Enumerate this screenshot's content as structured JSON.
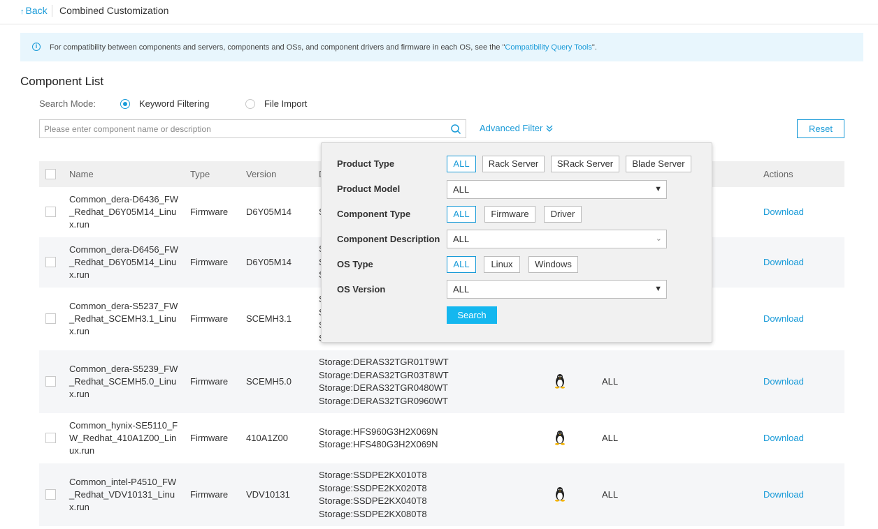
{
  "header": {
    "back_arrow": "↑",
    "back_label": "Back",
    "title": "Combined Customization"
  },
  "notice": {
    "icon": "info-icon",
    "text_before": "For compatibility between components and servers, components and OSs, and component drivers and firmware in each OS, see the \"",
    "link": "Compatibility Query Tools",
    "text_after": "\"."
  },
  "section_title": "Component List",
  "search_mode": {
    "label": "Search Mode:",
    "options": [
      "Keyword Filtering",
      "File Import"
    ],
    "selected": "Keyword Filtering"
  },
  "search": {
    "placeholder": "Please enter component name or description",
    "value": ""
  },
  "advanced_filter_label": "Advanced Filter",
  "reset_label": "Reset",
  "table": {
    "columns": [
      "Name",
      "Type",
      "Version",
      "D",
      "Actions"
    ],
    "rows": [
      {
        "name": "Common_dera-D6436_FW_Redhat_D6Y05M14_Linux.run",
        "type": "Firmware",
        "version": "D6Y05M14",
        "desc": [
          "S"
        ],
        "os": "",
        "os_version": "",
        "action": "Download"
      },
      {
        "name": "Common_dera-D6456_FW_Redhat_D6Y05M14_Linux.run",
        "type": "Firmware",
        "version": "D6Y05M14",
        "desc": [
          "S",
          "S",
          "S"
        ],
        "os": "",
        "os_version": "",
        "action": "Download"
      },
      {
        "name": "Common_dera-S5237_FW_Redhat_SCEMH3.1_Linux.run",
        "type": "Firmware",
        "version": "SCEMH3.1",
        "desc": [
          "S",
          "S",
          "S",
          "S"
        ],
        "os": "",
        "os_version": "",
        "action": "Download"
      },
      {
        "name": "Common_dera-S5239_FW_Redhat_SCEMH5.0_Linux.run",
        "type": "Firmware",
        "version": "SCEMH5.0",
        "desc": [
          "Storage:DERAS32TGR01T9WT",
          "Storage:DERAS32TGR03T8WT",
          "Storage:DERAS32TGR0480WT",
          "Storage:DERAS32TGR0960WT"
        ],
        "os": "linux-penguin-icon",
        "os_version": "ALL",
        "action": "Download"
      },
      {
        "name": "Common_hynix-SE5110_FW_Redhat_410A1Z00_Linux.run",
        "type": "Firmware",
        "version": "410A1Z00",
        "desc": [
          "Storage:HFS960G3H2X069N",
          "Storage:HFS480G3H2X069N"
        ],
        "os": "linux-penguin-icon",
        "os_version": "ALL",
        "action": "Download"
      },
      {
        "name": "Common_intel-P4510_FW_Redhat_VDV10131_Linux.run",
        "type": "Firmware",
        "version": "VDV10131",
        "desc": [
          "Storage:SSDPE2KX010T8",
          "Storage:SSDPE2KX020T8",
          "Storage:SSDPE2KX040T8",
          "Storage:SSDPE2KX080T8"
        ],
        "os": "linux-penguin-icon",
        "os_version": "ALL",
        "action": "Download"
      }
    ]
  },
  "filter_popup": {
    "product_type": {
      "label": "Product Type",
      "options": [
        "ALL",
        "Rack Server",
        "SRack Server",
        "Blade Server"
      ],
      "selected": "ALL"
    },
    "product_model": {
      "label": "Product Model",
      "value": "ALL"
    },
    "component_type": {
      "label": "Component Type",
      "options": [
        "ALL",
        "Firmware",
        "Driver"
      ],
      "selected": "ALL"
    },
    "component_description": {
      "label": "Component Description",
      "value": "ALL"
    },
    "os_type": {
      "label": "OS Type",
      "options": [
        "ALL",
        "Linux",
        "Windows"
      ],
      "selected": "ALL"
    },
    "os_version": {
      "label": "OS Version",
      "value": "ALL"
    },
    "search_label": "Search"
  },
  "colors": {
    "accent": "#1a9bd8",
    "button": "#14b7ef",
    "notice_bg": "#e8f6fd"
  }
}
